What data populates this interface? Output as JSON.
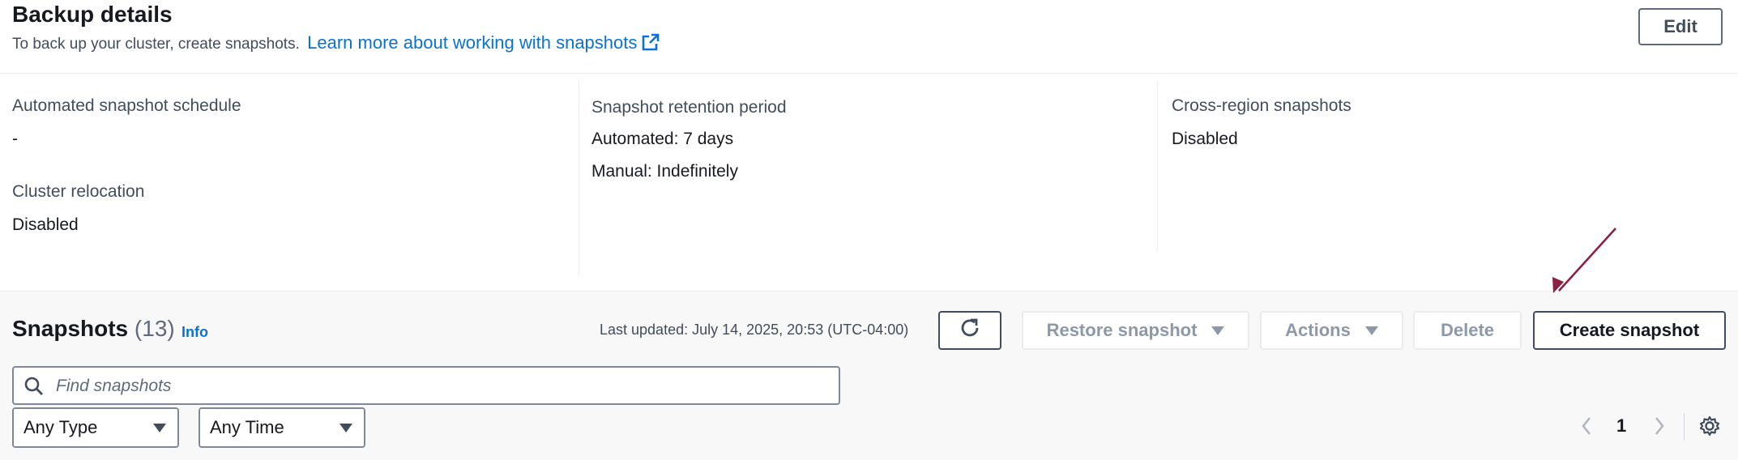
{
  "header": {
    "title": "Backup details",
    "subtitle": "To back up your cluster, create snapshots.",
    "learn_more": "Learn more about working with snapshots",
    "edit_label": "Edit"
  },
  "details": {
    "automated_schedule": {
      "label": "Automated snapshot schedule",
      "value": "-"
    },
    "cluster_relocation": {
      "label": "Cluster relocation",
      "value": "Disabled"
    },
    "retention": {
      "label": "Snapshot retention period",
      "automated": "Automated: 7 days",
      "manual": "Manual: Indefinitely"
    },
    "cross_region": {
      "label": "Cross-region snapshots",
      "value": "Disabled"
    }
  },
  "snapshots": {
    "title": "Snapshots",
    "count": "(13)",
    "info": "Info",
    "last_updated": "Last updated: July 14, 2025, 20:53 (UTC-04:00)",
    "restore_label": "Restore snapshot",
    "actions_label": "Actions",
    "delete_label": "Delete",
    "create_label": "Create snapshot",
    "search_placeholder": "Find snapshots",
    "type_filter": "Any Type",
    "time_filter": "Any Time",
    "page": "1"
  },
  "colors": {
    "link": "#0972d3",
    "annotation_arrow": "#8b2140"
  },
  "icons": [
    "external-link-icon",
    "refresh-icon",
    "caret-down-icon",
    "search-icon",
    "chevron-left-icon",
    "chevron-right-icon",
    "gear-icon",
    "annotation-arrow-icon"
  ]
}
